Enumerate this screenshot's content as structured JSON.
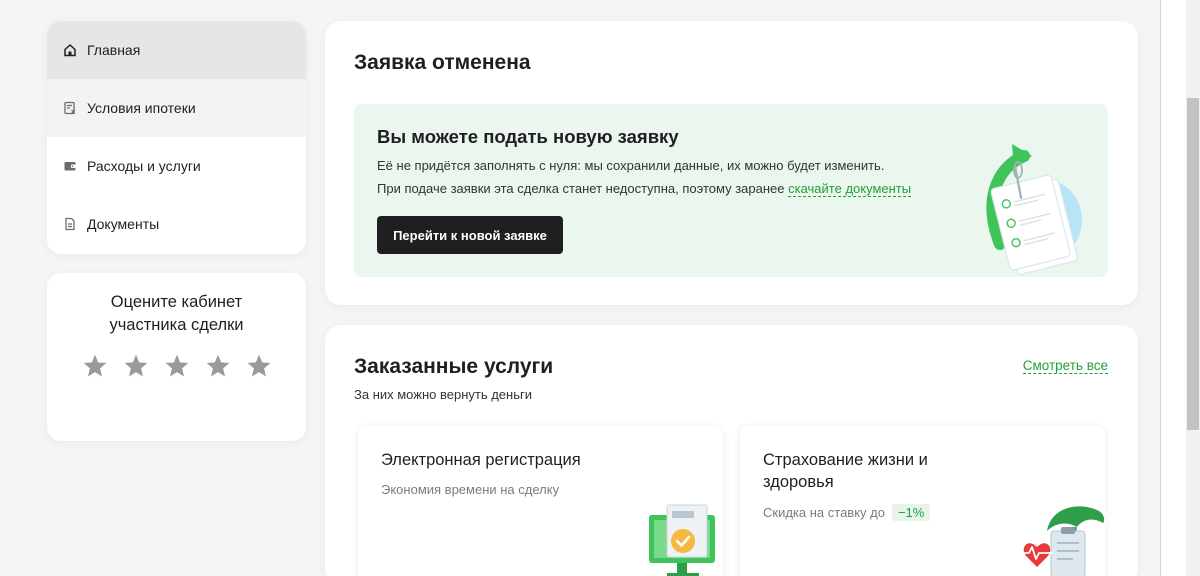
{
  "sidebar": {
    "items": [
      {
        "label": "Главная",
        "icon": "home-icon"
      },
      {
        "label": "Условия ипотеки",
        "icon": "document-percent-icon"
      },
      {
        "label": "Расходы и услуги",
        "icon": "wallet-icon"
      },
      {
        "label": "Документы",
        "icon": "file-icon"
      }
    ]
  },
  "rating": {
    "title": "Оцените кабинет участника сделки",
    "stars": 5,
    "star_color": "#9a9a9a"
  },
  "cancel": {
    "title": "Заявка отменена",
    "promo": {
      "title": "Вы можете подать новую заявку",
      "line1": "Её не придётся заполнять с нуля: мы сохранили данные, их можно будет изменить.",
      "line2_prefix": "При подаче заявки эта сделка станет недоступна, поэтому заранее ",
      "line2_link": "скачайте документы",
      "button": "Перейти к новой заявке",
      "background": "#ebf6ef"
    }
  },
  "services": {
    "title": "Заказанные услуги",
    "subtitle": "За них можно вернуть деньги",
    "see_all": "Смотреть все",
    "items": [
      {
        "title": "Электронная регистрация",
        "subtitle": "Экономия времени на сделку",
        "icon": "monitor-check-icon"
      },
      {
        "title": "Страхование жизни и здоровья",
        "subtitle": "Скидка на ставку до",
        "badge": "−1%",
        "icon": "health-insurance-icon"
      }
    ]
  },
  "colors": {
    "accent": "#21a038",
    "dark_button": "#1f1f22"
  }
}
